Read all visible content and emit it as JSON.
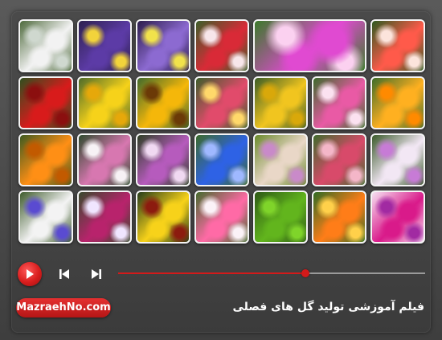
{
  "player": {
    "site_label": "MazraehNo.com",
    "title": "فیلم آموزشی تولید گل های فصلی",
    "progress": 0.61,
    "accent": "#d31a1a"
  },
  "gallery": {
    "tiles": [
      {
        "name": "tile-babys-breath",
        "colors": [
          "#f2f2f2",
          "#cfd8cf",
          "#4f6b3d"
        ],
        "wide": false
      },
      {
        "name": "tile-pansies",
        "colors": [
          "#5c3ba6",
          "#f2d33b",
          "#2f2250"
        ],
        "wide": false
      },
      {
        "name": "tile-violas",
        "colors": [
          "#8c6ad1",
          "#f1e24b",
          "#2c1d4c"
        ],
        "wide": false
      },
      {
        "name": "tile-sweet-william-red",
        "colors": [
          "#d92a37",
          "#f7e6ea",
          "#3c5f2a"
        ],
        "wide": false
      },
      {
        "name": "tile-ice-plant",
        "colors": [
          "#e04ad1",
          "#fbd1f0",
          "#3b7a2a"
        ],
        "wide": true
      },
      {
        "name": "tile-dahlias",
        "colors": [
          "#ff5a4a",
          "#fce4dc",
          "#2e5a20"
        ],
        "wide": false
      },
      {
        "name": "tile-red-poppies",
        "colors": [
          "#d81b1b",
          "#8b0f0f",
          "#2f4f1f"
        ],
        "wide": false
      },
      {
        "name": "tile-coreopsis",
        "colors": [
          "#f6d21a",
          "#e6a80a",
          "#4f6b2a"
        ],
        "wide": false
      },
      {
        "name": "tile-sunflower",
        "colors": [
          "#f5b70a",
          "#6b3a07",
          "#416a2c"
        ],
        "wide": false
      },
      {
        "name": "tile-snapdragons",
        "colors": [
          "#e14b6b",
          "#ffd86a",
          "#3d5e2b"
        ],
        "wide": false
      },
      {
        "name": "tile-tansy",
        "colors": [
          "#f1c51f",
          "#d9a80a",
          "#3c5d26"
        ],
        "wide": false
      },
      {
        "name": "tile-cleome",
        "colors": [
          "#e95aa5",
          "#fbe1f0",
          "#3c6a2b"
        ],
        "wide": false
      },
      {
        "name": "tile-california-poppy",
        "colors": [
          "#ffb020",
          "#ff8a00",
          "#3e6c2a"
        ],
        "wide": false
      },
      {
        "name": "tile-marigolds",
        "colors": [
          "#ff8f15",
          "#c25a00",
          "#3e5a20"
        ],
        "wide": false
      },
      {
        "name": "tile-phlox",
        "colors": [
          "#d777b0",
          "#f7f2f5",
          "#2f4a2d"
        ],
        "wide": false
      },
      {
        "name": "tile-geranium",
        "colors": [
          "#b65bbd",
          "#f0d9f2",
          "#2d3f24"
        ],
        "wide": false
      },
      {
        "name": "tile-cornflower",
        "colors": [
          "#2e62e5",
          "#9fb8ff",
          "#3c6a2b"
        ],
        "wide": false
      },
      {
        "name": "tile-chrysanthemums",
        "colors": [
          "#e9d7c7",
          "#c98ac9",
          "#6b8a2c"
        ],
        "wide": false
      },
      {
        "name": "tile-sweet-peas",
        "colors": [
          "#d84a6a",
          "#f4b6c8",
          "#3f6b2c"
        ],
        "wide": false
      },
      {
        "name": "tile-stock",
        "colors": [
          "#f2e7f4",
          "#c77bd6",
          "#3a5a2a"
        ],
        "wide": false
      },
      {
        "name": "tile-larkspur",
        "colors": [
          "#f3f3f3",
          "#5a4bd1",
          "#3f5c2d"
        ],
        "wide": false
      },
      {
        "name": "tile-verbena",
        "colors": [
          "#b8236c",
          "#f0e5ff",
          "#3a4a2e"
        ],
        "wide": false
      },
      {
        "name": "tile-gaillardia",
        "colors": [
          "#f7d21a",
          "#8c1b0f",
          "#263c1a"
        ],
        "wide": false
      },
      {
        "name": "tile-dianthus",
        "colors": [
          "#ff6aa6",
          "#fbf2f7",
          "#456b2e"
        ],
        "wide": false
      },
      {
        "name": "tile-kochia",
        "colors": [
          "#62b51d",
          "#7fd42a",
          "#2e5a16"
        ],
        "wide": false
      },
      {
        "name": "tile-nasturtium",
        "colors": [
          "#ff7d18",
          "#ffd04a",
          "#2f6b24"
        ],
        "wide": false
      },
      {
        "name": "tile-candytuft",
        "colors": [
          "#d91a8a",
          "#a12aa2",
          "#f6e2f2"
        ],
        "wide": false
      }
    ]
  }
}
